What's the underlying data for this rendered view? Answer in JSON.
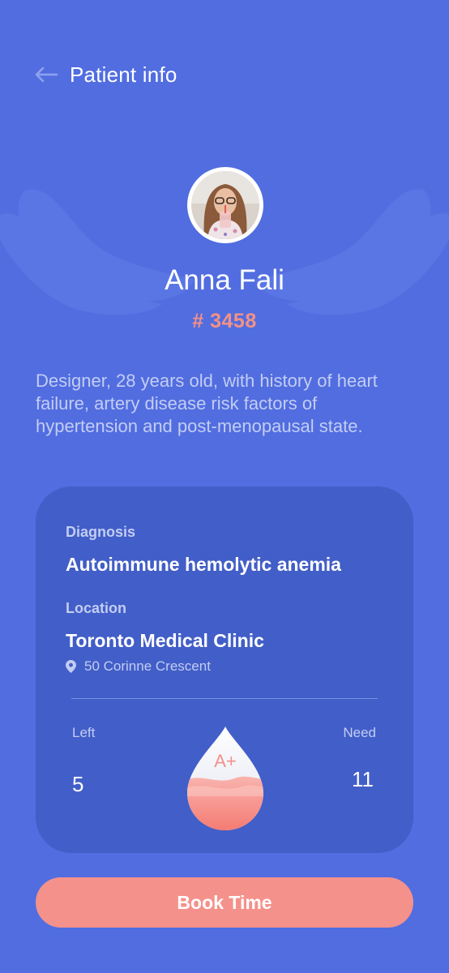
{
  "header": {
    "title": "Patient info",
    "back_icon": "arrow-left-icon"
  },
  "patient": {
    "name": "Anna Fali",
    "id": "# 3458",
    "bio": "Designer, 28 years old, with history of heart failure, artery disease risk factors of hypertension and post-menopausal state."
  },
  "details": {
    "diagnosis_label": "Diagnosis",
    "diagnosis": "Autoimmune hemolytic anemia",
    "location_label": "Location",
    "location": "Toronto Medical Clinic",
    "address": "50 Corinne Crescent",
    "address_icon": "location-pin-icon"
  },
  "blood": {
    "left_label": "Left",
    "left_value": "5",
    "need_label": "Need",
    "need_value": "11",
    "type": "A+",
    "fill_level": 0.5
  },
  "actions": {
    "book_label": "Book Time"
  },
  "colors": {
    "background": "#516de0",
    "card": "#425ec8",
    "accent": "#f5918b",
    "id_color": "#f39186",
    "muted_text": "#c3cdf3"
  }
}
